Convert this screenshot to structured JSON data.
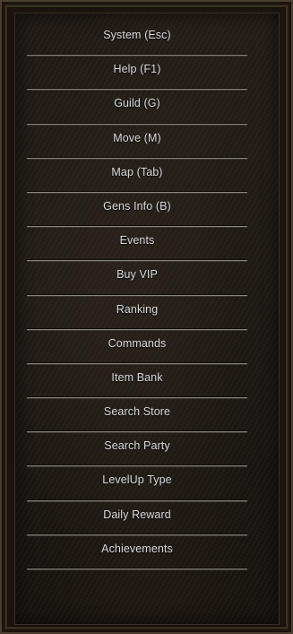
{
  "menu": {
    "items": [
      {
        "label": "System (Esc)"
      },
      {
        "label": "Help (F1)"
      },
      {
        "label": "Guild (G)"
      },
      {
        "label": "Move (M)"
      },
      {
        "label": "Map (Tab)"
      },
      {
        "label": "Gens Info (B)"
      },
      {
        "label": "Events"
      },
      {
        "label": "Buy VIP"
      },
      {
        "label": "Ranking"
      },
      {
        "label": "Commands"
      },
      {
        "label": "Item Bank"
      },
      {
        "label": "Search Store"
      },
      {
        "label": "Search Party"
      },
      {
        "label": "LevelUp Type"
      },
      {
        "label": "Daily Reward"
      },
      {
        "label": "Achievements"
      }
    ]
  },
  "colors": {
    "frame_border": "#4a3f31",
    "panel_background": "#1d1814",
    "label_text": "#dcdcdc",
    "divider_highlight": "#8a8680"
  }
}
